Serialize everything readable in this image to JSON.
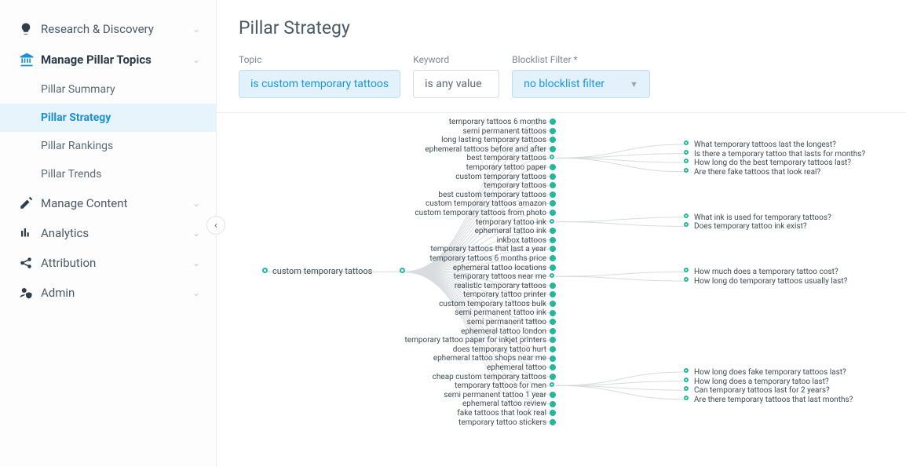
{
  "page_title": "Pillar Strategy",
  "sidebar": {
    "items": [
      {
        "label": "Research & Discovery",
        "icon": "bulb",
        "expandable": true
      },
      {
        "label": "Manage Pillar Topics",
        "icon": "pillar",
        "expandable": true,
        "bold": true
      },
      {
        "label": "Pillar Summary",
        "sub": true
      },
      {
        "label": "Pillar Strategy",
        "sub": true,
        "active": true
      },
      {
        "label": "Pillar Rankings",
        "sub": true
      },
      {
        "label": "Pillar Trends",
        "sub": true
      },
      {
        "label": "Manage Content",
        "icon": "edit",
        "expandable": true
      },
      {
        "label": "Analytics",
        "icon": "bars",
        "expandable": true
      },
      {
        "label": "Attribution",
        "icon": "share",
        "expandable": true
      },
      {
        "label": "Admin",
        "icon": "user-shield",
        "expandable": true
      }
    ]
  },
  "filters": {
    "topic": {
      "label": "Topic",
      "value": "is custom temporary tattoos"
    },
    "keyword": {
      "label": "Keyword",
      "value": "is any value"
    },
    "blocklist": {
      "label": "Blocklist Filter *",
      "value": "no blocklist filter"
    }
  },
  "chart_data": {
    "type": "tree",
    "root": "custom temporary tattoos",
    "mid_nodes": [
      {
        "label": "temporary tattoos 6 months",
        "open": false
      },
      {
        "label": "semi permanent tattoos",
        "open": false
      },
      {
        "label": "long lasting temporary tattoos",
        "open": false
      },
      {
        "label": "ephemeral tattoos before and after",
        "open": false
      },
      {
        "label": "best temporary tattoos",
        "open": true,
        "leaves": [
          "What temporary tattoos last the longest?",
          "Is there a temporary tattoo that lasts for months?",
          "How long do the best temporary tattoos last?",
          "Are there fake tattoos that look real?"
        ]
      },
      {
        "label": "temporary tattoo paper",
        "open": false
      },
      {
        "label": "custom temporary tattoos",
        "open": false
      },
      {
        "label": "temporary tattoos",
        "open": false
      },
      {
        "label": "best custom temporary tattoos",
        "open": false
      },
      {
        "label": "custom temporary tattoos amazon",
        "open": false
      },
      {
        "label": "custom temporary tattoos from photo",
        "open": false
      },
      {
        "label": "temporary tattoo ink",
        "open": true,
        "leaves": [
          "What ink is used for temporary tattoos?",
          "Does temporary tattoo ink exist?"
        ]
      },
      {
        "label": "ephemeral tattoo ink",
        "open": false
      },
      {
        "label": "inkbox tattoos",
        "open": false
      },
      {
        "label": "temporary tattoos that last a year",
        "open": false
      },
      {
        "label": "temporary tattoos 6 months price",
        "open": false
      },
      {
        "label": "ephemeral tattoo locations",
        "open": false
      },
      {
        "label": "temporary tattoos near me",
        "open": true,
        "leaves": [
          "How much does a temporary tattoo cost?",
          "How long do temporary tattoos usually last?"
        ]
      },
      {
        "label": "realistic temporary tattoos",
        "open": false
      },
      {
        "label": "temporary tattoo printer",
        "open": false
      },
      {
        "label": "custom temporary tattoos bulk",
        "open": false
      },
      {
        "label": "semi permanent tattoo ink",
        "open": false
      },
      {
        "label": "semi permanent tattoo",
        "open": false
      },
      {
        "label": "ephemeral tattoo london",
        "open": false
      },
      {
        "label": "temporary tattoo paper for inkjet printers",
        "open": false
      },
      {
        "label": "does temporary tattoo hurt",
        "open": false
      },
      {
        "label": "ephemeral tattoo shops near me",
        "open": false
      },
      {
        "label": "ephemeral tattoo",
        "open": false
      },
      {
        "label": "cheap custom temporary tattoos",
        "open": false
      },
      {
        "label": "temporary tattoos for men",
        "open": true,
        "leaves": [
          "How long does fake temporary tattoos last?",
          "How long does a temporary tatoo last?",
          "Can temporary tattoos last for 2 years?",
          "Are there temporary tattoos that last months?"
        ]
      },
      {
        "label": "semi permanent tattoo 1 year",
        "open": false
      },
      {
        "label": "ephemeral tattoo review",
        "open": false
      },
      {
        "label": "fake tattoos that look real",
        "open": false
      },
      {
        "label": "temporary tattoo stickers",
        "open": false
      }
    ]
  }
}
